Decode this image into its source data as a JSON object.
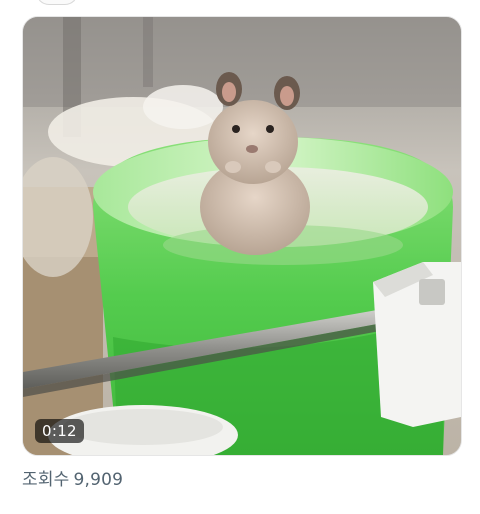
{
  "video": {
    "duration": "0:12"
  },
  "stats": {
    "views_label": "조회수",
    "views_value": "9,909"
  }
}
